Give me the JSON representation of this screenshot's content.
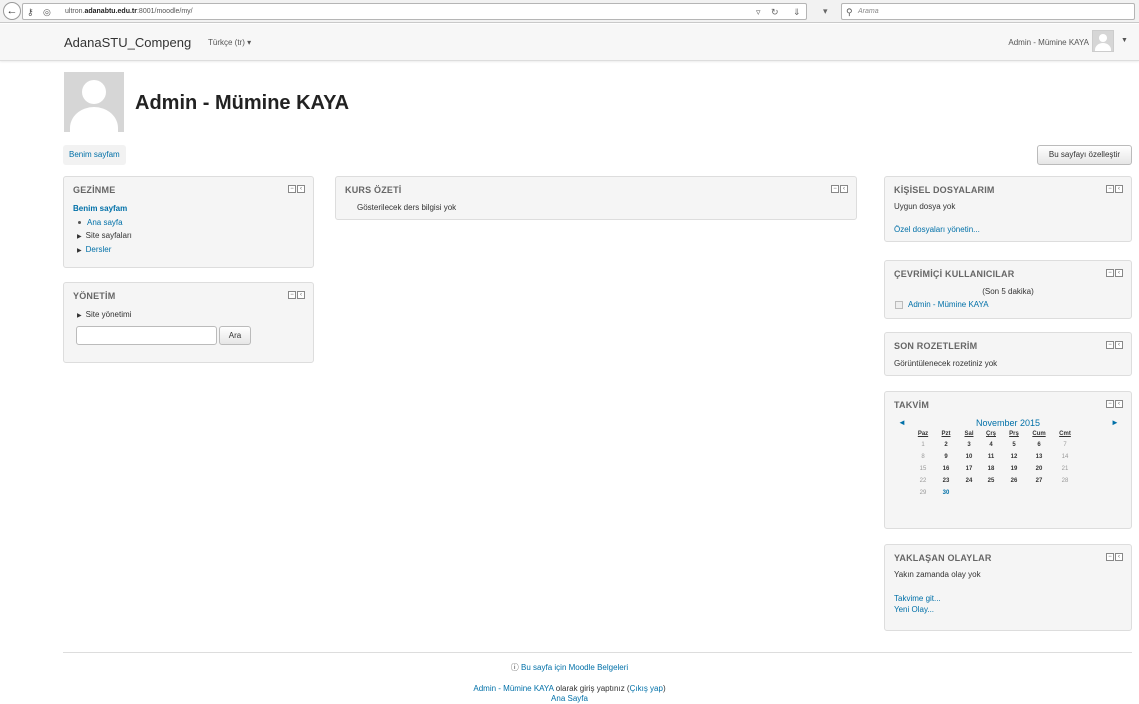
{
  "browser": {
    "url_prefix": "ultron.",
    "url_domain": "adanabtu.edu.tr",
    "url_path": ":8001/moodle/my/",
    "search_placeholder": "Arama"
  },
  "navbar": {
    "brand": "AdanaSTU_Compeng",
    "language": "Türkçe (tr) ▾",
    "user": "Admin - Mümine KAYA"
  },
  "header": {
    "title": "Admin - Mümine KAYA",
    "breadcrumb": "Benim sayfam",
    "customize_button": "Bu sayfayı özelleştir"
  },
  "gezinme": {
    "title": "GEZİNME",
    "home": "Benim sayfam",
    "items": [
      "Ana sayfa",
      "Site sayfaları",
      "Dersler"
    ]
  },
  "yonetim": {
    "title": "YÖNETİM",
    "item": "Site yönetimi",
    "search_button": "Ara"
  },
  "kurs": {
    "title": "KURS ÖZETİ",
    "empty": "Gösterilecek ders bilgisi yok"
  },
  "dosyalar": {
    "title": "KİŞİSEL DOSYALARIM",
    "empty": "Uygun dosya yok",
    "manage_link": "Özel dosyaları yönetin..."
  },
  "online": {
    "title": "ÇEVRİMİÇİ KULLANICILAR",
    "period": "(Son 5 dakika)",
    "user": "Admin - Mümine KAYA"
  },
  "rozetler": {
    "title": "SON ROZETLERİM",
    "empty": "Görüntülenecek rozetiniz yok"
  },
  "takvim": {
    "title": "TAKVİM",
    "prev": "◄",
    "next": "►",
    "month": "November 2015",
    "days": [
      "Paz",
      "Pzt",
      "Sal",
      "Çrş",
      "Prş",
      "Cum",
      "Cmt"
    ],
    "weeks": [
      [
        "1",
        "2",
        "3",
        "4",
        "5",
        "6",
        "7"
      ],
      [
        "8",
        "9",
        "10",
        "11",
        "12",
        "13",
        "14"
      ],
      [
        "15",
        "16",
        "17",
        "18",
        "19",
        "20",
        "21"
      ],
      [
        "22",
        "23",
        "24",
        "25",
        "26",
        "27",
        "28"
      ],
      [
        "29",
        "30",
        "",
        "",
        "",
        "",
        ""
      ]
    ],
    "today": "30"
  },
  "olaylar": {
    "title": "YAKLAŞAN OLAYLAR",
    "empty": "Yakın zamanda olay yok",
    "calendar_link": "Takvime git...",
    "new_event_link": "Yeni Olay..."
  },
  "footer": {
    "docs_icon": "ⓘ",
    "docs": "Bu sayfa için Moodle Belgeleri",
    "login_user": "Admin - Mümine KAYA",
    "login_mid": " olarak giriş yaptınız (",
    "logout": "Çıkış yap",
    "login_end": ")",
    "home": "Ana Sayfa"
  }
}
